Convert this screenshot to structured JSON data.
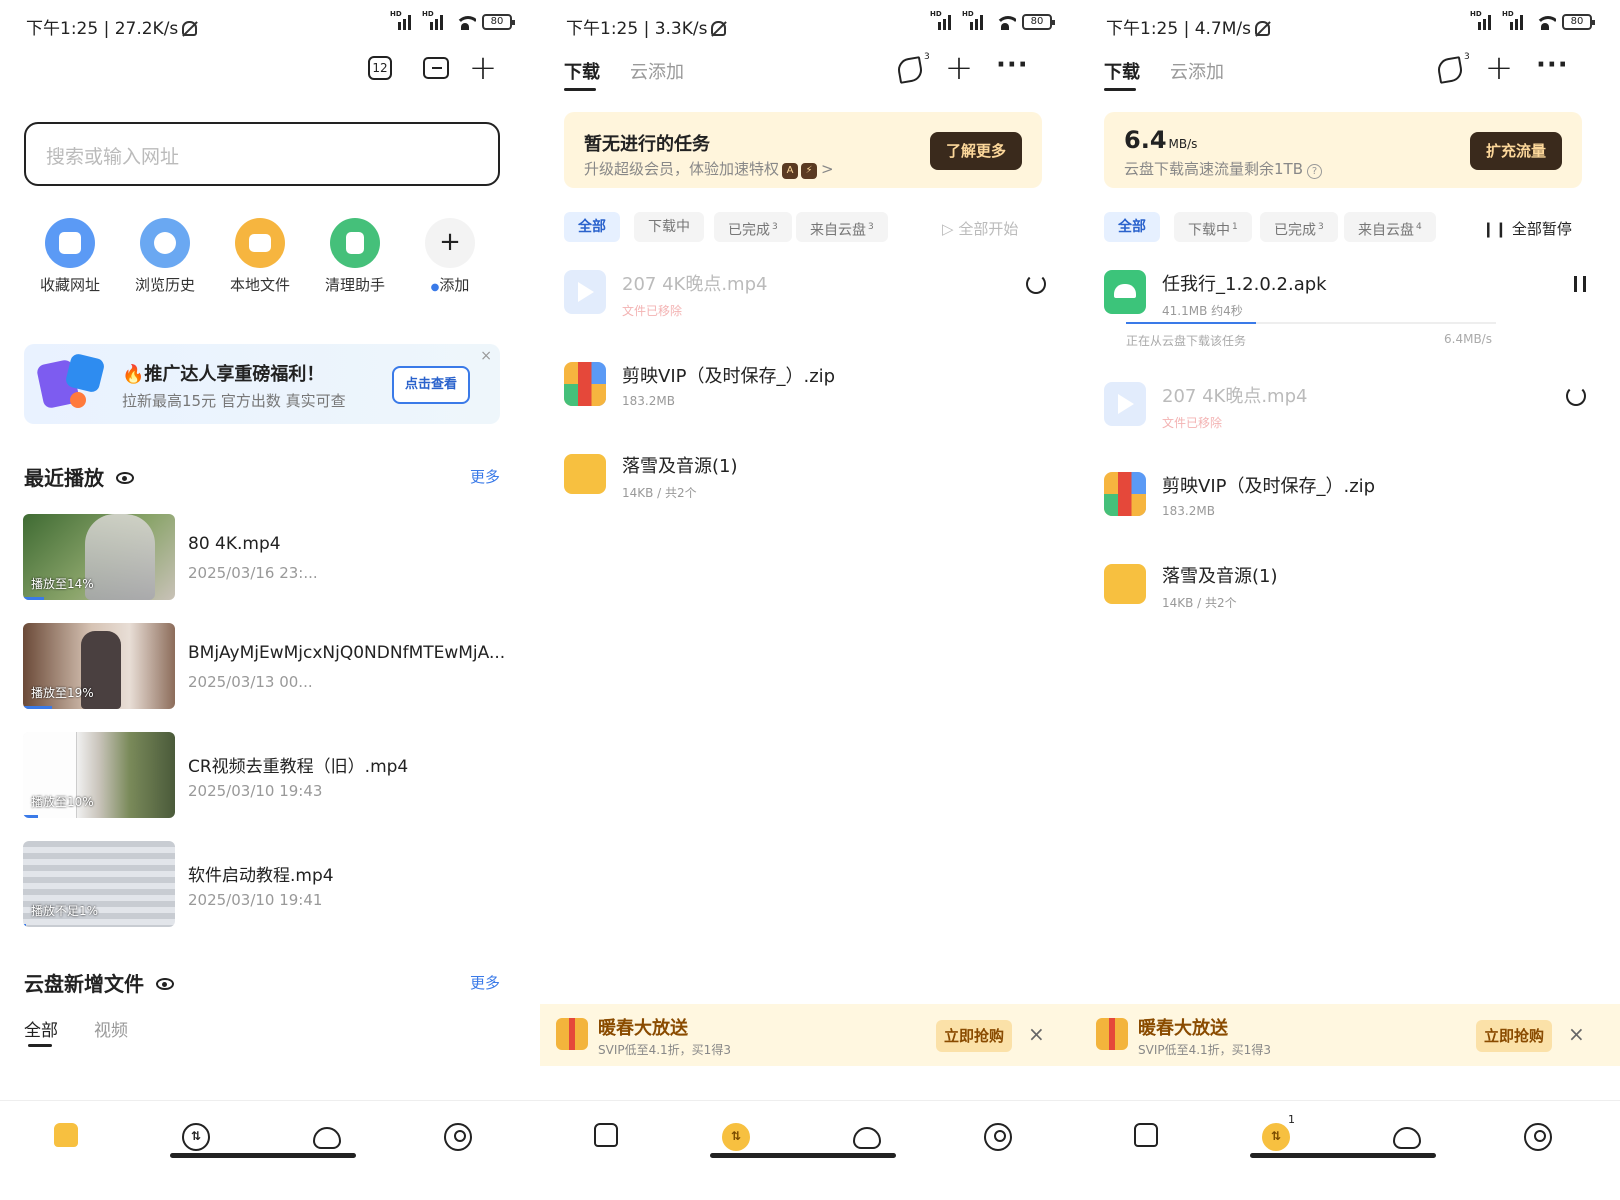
{
  "screens": {
    "home": {
      "status": {
        "time_speed": "下午1:25 | 27.2K/s",
        "battery": "80"
      },
      "tab_count": "12",
      "search_placeholder": "搜索或输入网址",
      "quick": [
        {
          "label": "收藏网址",
          "color": "#5b9af5"
        },
        {
          "label": "浏览历史",
          "color": "#6aa8f2"
        },
        {
          "label": "本地文件",
          "color": "#f6b53f"
        },
        {
          "label": "清理助手",
          "color": "#45c07a"
        },
        {
          "label": "添加",
          "color": "#f3f3f3"
        }
      ],
      "promo": {
        "title": "🔥推广达人享重磅福利！",
        "sub": "拉新最高15元 官方出数 真实可查",
        "button": "点击查看"
      },
      "recent": {
        "title": "最近播放",
        "more": "更多",
        "items": [
          {
            "title": "80 4K.mp4",
            "date": "2025/03/16 23:...",
            "badge": "播放至14%",
            "progress": 0.14,
            "thumb": "#5a7a4a"
          },
          {
            "title": "BMjAyMjEwMjcxNjQ0NDNfMTEwMjA...",
            "date": "2025/03/13 00...",
            "badge": "播放至19%",
            "progress": 0.19,
            "thumb": "#a98a7a"
          },
          {
            "title": "CR视频去重教程（旧）.mp4",
            "date": "2025/03/10 19:43",
            "badge": "播放至10%",
            "progress": 0.1,
            "thumb": "#7e8c6e"
          },
          {
            "title": "软件启动教程.mp4",
            "date": "2025/03/10 19:41",
            "badge": "播放不足1%",
            "progress": 0.01,
            "thumb": "#9aa0a8"
          }
        ]
      },
      "cloud": {
        "title": "云盘新增文件",
        "more": "更多",
        "tabs": [
          "全部",
          "视频"
        ]
      }
    },
    "downloads_idle": {
      "status": {
        "time_speed": "下午1:25 | 3.3K/s",
        "battery": "80"
      },
      "tabs": [
        "下载",
        "云添加"
      ],
      "rocket_badge": "3",
      "banner": {
        "title": "暂无进行的任务",
        "sub": "升级超级会员，体验加速特权",
        "button": "了解更多"
      },
      "chips": [
        {
          "label": "全部",
          "count": ""
        },
        {
          "label": "下载中",
          "count": ""
        },
        {
          "label": "已完成",
          "count": "3"
        },
        {
          "label": "来自云盘",
          "count": "3"
        }
      ],
      "right_action": "全部开始",
      "files": [
        {
          "name": "207 4K晚点.mp4",
          "sub": "文件已移除",
          "type": "video",
          "disabled": true
        },
        {
          "name": "剪映VIP（及时保存_）.zip",
          "sub": "183.2MB",
          "type": "zip",
          "disabled": false
        },
        {
          "name": "落雪及音源(1)",
          "sub": "14KB / 共2个",
          "type": "folder",
          "disabled": false
        }
      ],
      "bottom_promo": {
        "title": "暖春大放送",
        "sub": "SVIP低至4.1折，买1得3",
        "button": "立即抢购"
      }
    },
    "downloads_active": {
      "status": {
        "time_speed": "下午1:25 | 4.7M/s",
        "battery": "80"
      },
      "tabs": [
        "下载",
        "云添加"
      ],
      "rocket_badge": "3",
      "banner": {
        "speed": "6.4",
        "speed_unit": "MB/s",
        "sub": "云盘下载高速流量剩余1TB",
        "button": "扩充流量"
      },
      "chips": [
        {
          "label": "全部",
          "count": ""
        },
        {
          "label": "下载中",
          "count": "1"
        },
        {
          "label": "已完成",
          "count": "3"
        },
        {
          "label": "来自云盘",
          "count": "4"
        }
      ],
      "right_action": "全部暂停",
      "active_file": {
        "name": "任我行_1.2.0.2.apk",
        "sub": "41.1MB 约4秒",
        "status": "正在从云盘下载该任务",
        "rate": "6.4MB/s",
        "progress": 0.35
      },
      "files": [
        {
          "name": "207 4K晚点.mp4",
          "sub": "文件已移除",
          "type": "video",
          "disabled": true
        },
        {
          "name": "剪映VIP（及时保存_）.zip",
          "sub": "183.2MB",
          "type": "zip",
          "disabled": false
        },
        {
          "name": "落雪及音源(1)",
          "sub": "14KB / 共2个",
          "type": "folder",
          "disabled": false
        }
      ],
      "nav_badge": "1",
      "bottom_promo": {
        "title": "暖春大放送",
        "sub": "SVIP低至4.1折，买1得3",
        "button": "立即抢购"
      }
    }
  },
  "colors": {
    "accent": "#3a7ae8",
    "yellow": "#f7c040",
    "banner_bg": "#fff5dc"
  }
}
